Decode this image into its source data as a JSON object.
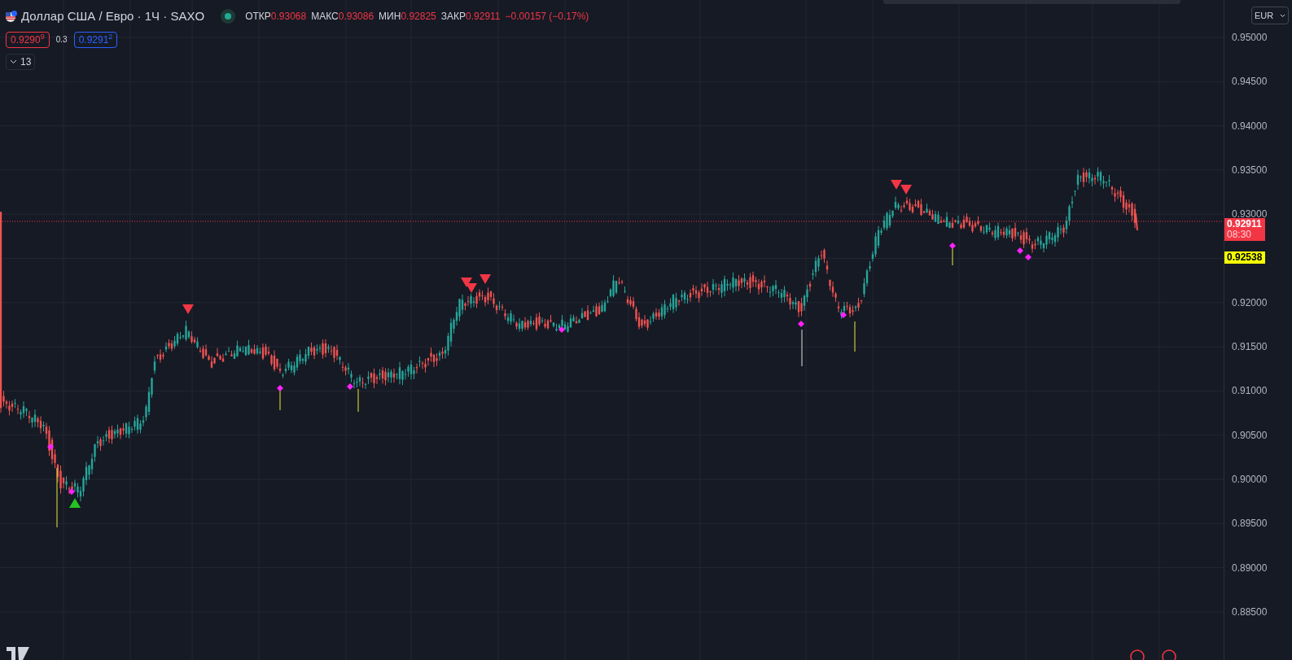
{
  "header": {
    "title": "Доллар США / Евро · 1Ч · SAXO",
    "market_open": true,
    "ohlc": [
      {
        "label": "ОТКР",
        "value": "0.93068"
      },
      {
        "label": "МАКС",
        "value": "0.93086"
      },
      {
        "label": "МИН",
        "value": "0.92825"
      },
      {
        "label": "ЗАКР",
        "value": "0.92911"
      }
    ],
    "change": "−0.00157 (−0.17%)"
  },
  "quote": {
    "sell": "0.9290$^{9}$",
    "spread": "0.3",
    "buy": "0.9291$^{2}$"
  },
  "indicators": {
    "count": "13",
    "expanded": false
  },
  "currency": "EUR",
  "price_axis": {
    "ticks_above_tags": [
      "0.95000",
      "0.94500",
      "0.94000",
      "0.93500",
      "0.93000"
    ],
    "ticks_below_tags": [
      "0.92000",
      "0.91500",
      "0.91000",
      "0.90500",
      "0.90000",
      "0.89500",
      "0.89000",
      "0.88500"
    ]
  },
  "tags": [
    {
      "kind": "last",
      "price": "0.92911",
      "countdown": "08:30",
      "color": "#f23645"
    },
    {
      "kind": "level",
      "price": "0.92538",
      "color": "#f5ff00"
    }
  ]
}
